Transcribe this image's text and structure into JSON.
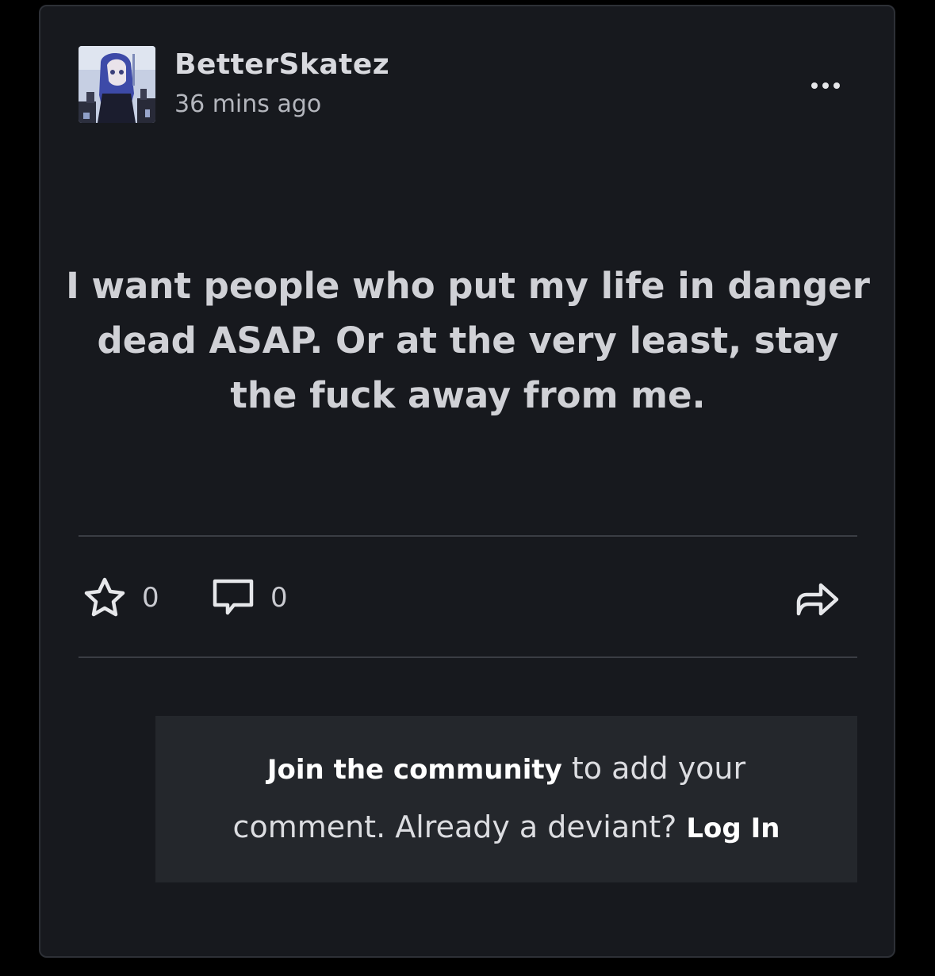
{
  "post": {
    "author": "BetterSkatez",
    "timestamp": "36 mins ago",
    "text": "I want people who put my life in danger dead ASAP. Or at the very least, stay the fuck away from me."
  },
  "actions": {
    "favourites_count": "0",
    "comments_count": "0",
    "more_icon": "more-dots-icon",
    "fav_icon": "star-outline-icon",
    "comment_icon": "speech-bubble-icon",
    "share_icon": "share-arrow-icon"
  },
  "join": {
    "join_link": "Join the community",
    "middle_text": " to add your comment. Already a deviant? ",
    "login_link": "Log In"
  },
  "colors": {
    "background": "#000000",
    "card": "#17191e",
    "join_box": "#24272c",
    "text": "#d0d1d6"
  }
}
